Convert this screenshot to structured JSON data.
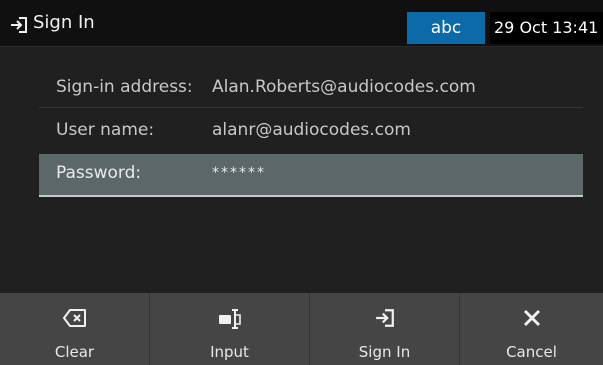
{
  "header": {
    "title": "Sign In",
    "title_icon": "sign-in-icon",
    "input_mode": "abc",
    "datetime": "29 Oct 13:41"
  },
  "form": {
    "fields": [
      {
        "label": "Sign-in address:",
        "value": "Alan.Roberts@audiocodes.com"
      },
      {
        "label": "User name:",
        "value": "alanr@audiocodes.com"
      },
      {
        "label": "Password:",
        "value": "******"
      }
    ]
  },
  "softkeys": [
    {
      "label": "Clear",
      "icon": "backspace-icon"
    },
    {
      "label": "Input",
      "icon": "input-mode-icon"
    },
    {
      "label": "Sign In",
      "icon": "sign-in-icon"
    },
    {
      "label": "Cancel",
      "icon": "close-icon"
    }
  ],
  "colors": {
    "mode_badge": "#0c6aa9",
    "selected_row": "#5b6768",
    "softkey_bar": "#454545",
    "background": "#202020"
  }
}
